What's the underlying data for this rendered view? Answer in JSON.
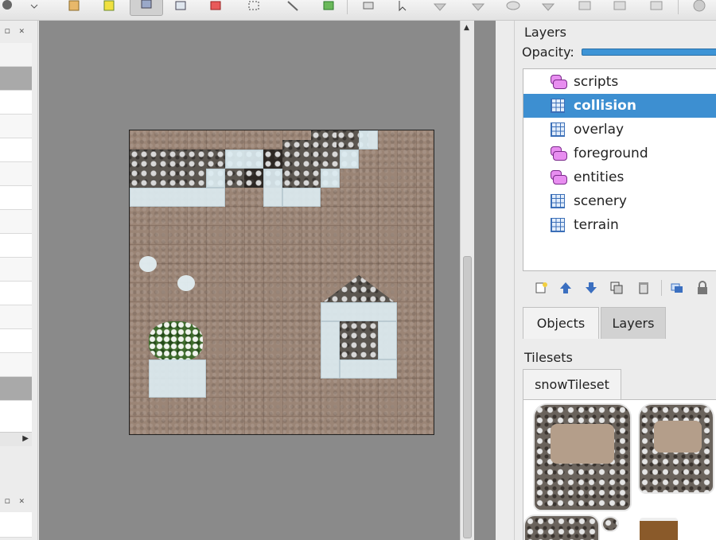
{
  "toolbar": {
    "buttons": [
      "stamp-icon",
      "export-icon",
      "edit-icon",
      "eraser-icon",
      "select-icon",
      "fill-icon",
      "rect-select-icon",
      "wand-icon",
      "pointer-icon",
      "shape-icon",
      "polygon-icon",
      "pin-icon",
      "ellipse-icon",
      "ruler-icon",
      "monitor-icon",
      "camera-icon",
      "window-icon",
      "spray-icon"
    ]
  },
  "left_dock": {
    "float_control": "◻",
    "close_control": "✕",
    "scroll_right": "▶"
  },
  "map": {
    "scroll_up": "▲"
  },
  "layers_panel": {
    "title": "Layers",
    "opacity_label": "Opacity:",
    "opacity_value": 1.0,
    "layers": [
      {
        "name": "scripts",
        "type": "object"
      },
      {
        "name": "collision",
        "type": "tile",
        "selected": true
      },
      {
        "name": "overlay",
        "type": "tile"
      },
      {
        "name": "foreground",
        "type": "object"
      },
      {
        "name": "entities",
        "type": "object"
      },
      {
        "name": "scenery",
        "type": "tile"
      },
      {
        "name": "terrain",
        "type": "tile"
      }
    ],
    "layer_actions": [
      "new-layer-icon",
      "move-up-icon",
      "move-down-icon",
      "duplicate-icon",
      "delete-icon",
      "toggle-other-layers-icon",
      "lock-icon"
    ]
  },
  "tabs": {
    "objects": "Objects",
    "layers": "Layers"
  },
  "tilesets_panel": {
    "title": "Tilesets",
    "tab": "snowTileset"
  },
  "colors": {
    "selection": "#3d8fd1",
    "opacity_bar": "#3d94d6",
    "map_background": "#8a8a8a",
    "collision_tile": "#dcebf0"
  }
}
